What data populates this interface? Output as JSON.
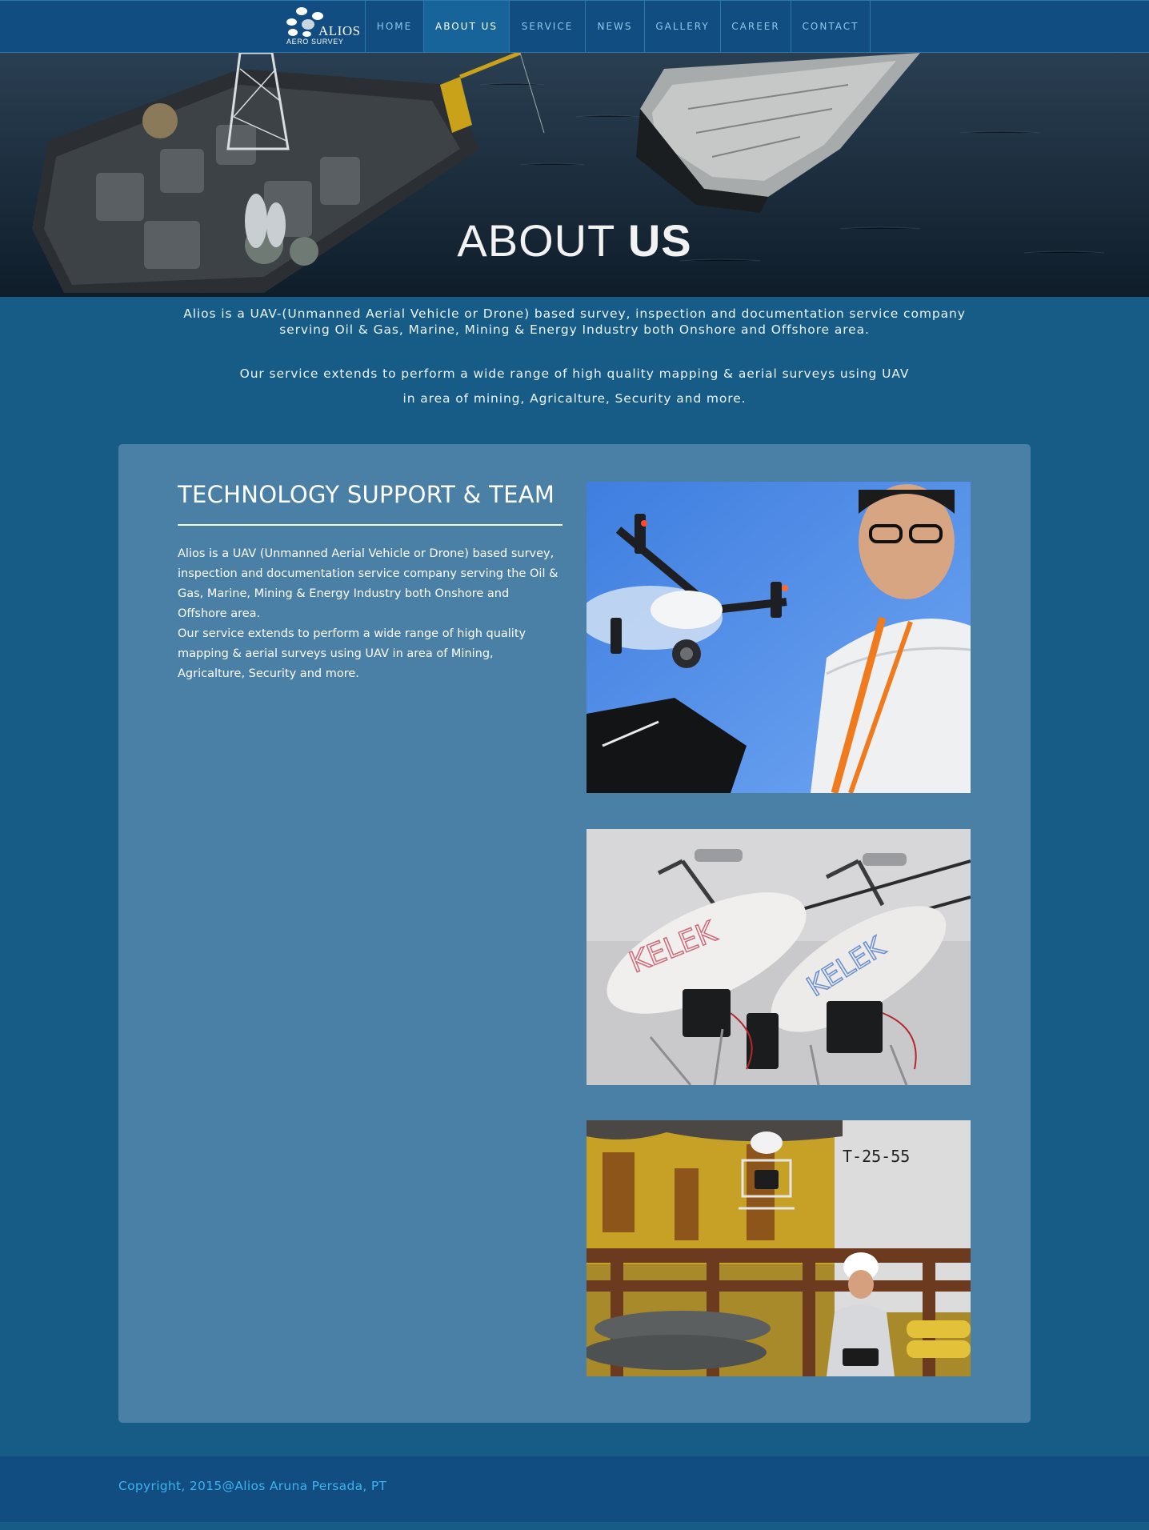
{
  "nav": {
    "logo": {
      "brand": "ALIOS",
      "subtitle": "AERO SURVEY"
    },
    "items": [
      {
        "label": "HOME",
        "active": false
      },
      {
        "label": "ABOUT US",
        "active": true
      },
      {
        "label": "SERVICE",
        "active": false
      },
      {
        "label": "NEWS",
        "active": false
      },
      {
        "label": "GALLERY",
        "active": false
      },
      {
        "label": "CAREER",
        "active": false
      },
      {
        "label": "CONTACT",
        "active": false
      }
    ]
  },
  "hero": {
    "title_light": "ABOUT",
    "title_bold": "US"
  },
  "intro": {
    "line1": "Alios is a UAV-(Unmanned Aerial Vehicle or Drone) based survey, inspection and documentation service company",
    "line2": "serving Oil & Gas, Marine, Mining & Energy Industry both Onshore and Offshore area.",
    "line3": "Our service extends to perform a wide range of high quality mapping & aerial surveys using UAV",
    "line4": "in area of mining, Agricalture, Security and more."
  },
  "panel": {
    "title": "TECHNOLOGY SUPPORT & TEAM",
    "paragraph1": "Alios is a UAV (Unmanned Aerial Vehicle or Drone) based survey, inspection and documentation service company serving the Oil & Gas, Marine, Mining & Energy Industry both Onshore and Offshore area.",
    "paragraph2": "Our service extends to perform a wide range of high quality mapping & aerial surveys using UAV in area of Mining, Agricalture, Security and more.",
    "photo2_label_a": "KELEK",
    "photo2_label_b": "KELEK",
    "photo3_sign": "T-25-55"
  },
  "footer": {
    "copyright": "Copyright, 2015@Alios Aruna Persada, PT"
  },
  "colors": {
    "page_bg": "#175b87",
    "nav_bg": "#114d80",
    "nav_active": "#17649b",
    "panel_bg": "#4a7fa6",
    "copyright_text": "#3fb2ef"
  }
}
